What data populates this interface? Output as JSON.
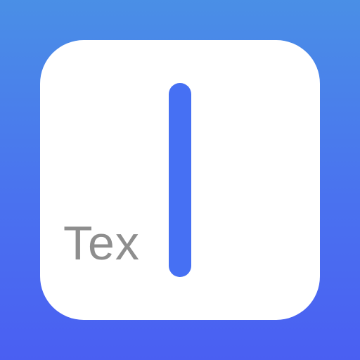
{
  "icon": {
    "label": "Tex",
    "cursor_icon": "text-cursor-icon",
    "colors": {
      "background_top": "#4a8fe6",
      "background_bottom": "#4a5ff2",
      "tile": "#ffffff",
      "label": "#8e8e8e",
      "cursor": "#4670f3"
    }
  }
}
